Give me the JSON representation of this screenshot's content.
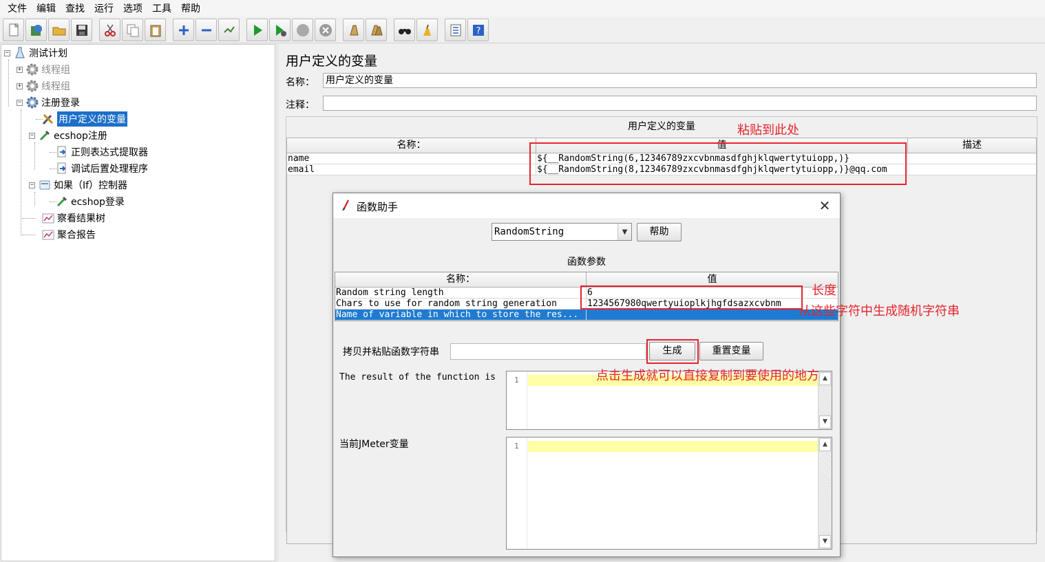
{
  "menu": [
    "文件",
    "编辑",
    "查找",
    "运行",
    "选项",
    "工具",
    "帮助"
  ],
  "toolbar_icons": [
    "new-icon",
    "templates-icon",
    "open-icon",
    "save-icon",
    "cut-icon",
    "copy-icon",
    "paste-icon",
    "expand-icon",
    "collapse-icon",
    "toggle-icon",
    "start-icon",
    "start-no-pause-icon",
    "stop-icon",
    "shutdown-icon",
    "clear-icon",
    "clear-all-icon",
    "search-icon",
    "reset-search-icon",
    "function-helper-icon",
    "help-icon"
  ],
  "tree": {
    "root": "测试计划",
    "thread_group_1": "线程组",
    "thread_group_2": "线程组",
    "register_login": "注册登录",
    "user_vars": "用户定义的变量",
    "ecshop_register": "ecshop注册",
    "regex_extractor": "正则表达式提取器",
    "debug_postprocessor": "调试后置处理程序",
    "if_controller": "如果（If）控制器",
    "ecshop_login": "ecshop登录",
    "view_results_tree": "察看结果树",
    "aggregate_report": "聚合报告"
  },
  "panel": {
    "title": "用户定义的变量",
    "name_label": "名称：",
    "name_value": "用户定义的变量",
    "comment_label": "注释：",
    "comment_value": "",
    "table_caption": "用户定义的变量",
    "columns": [
      "名称：",
      "值",
      "描述"
    ],
    "rows": [
      {
        "name": "name",
        "value": "${__RandomString(6,12346789zxcvbnmasdfghjklqwertytuiopp,)}",
        "desc": ""
      },
      {
        "name": "email",
        "value": "${__RandomString(8,12346789zxcvbnmasdfghjklqwertytuiopp,)}@qq.com",
        "desc": ""
      }
    ]
  },
  "dialog": {
    "title": "函数助手",
    "close": "✕",
    "function_select": "RandomString",
    "help_button": "帮助",
    "params_caption": "函数参数",
    "param_columns": [
      "名称：",
      "值"
    ],
    "params": [
      {
        "name": "Random string length",
        "value": "6"
      },
      {
        "name": "Chars to use for random string generation",
        "value": "1234567980qwertyuioplkjhgfdsazxcvbnm"
      },
      {
        "name": "Name of variable in which to store the res...",
        "value": ""
      }
    ],
    "copy_paste_label": "拷贝并粘贴函数字符串",
    "copy_paste_value": "",
    "generate_button": "生成",
    "reset_button": "重置变量",
    "result_label": "The result of the function is",
    "result_line_no": "1",
    "jmeter_vars_label": "当前JMeter变量",
    "jmeter_vars_line_no": "1"
  },
  "annotations": {
    "paste_here": "粘贴到此处",
    "length": "长度",
    "chars": "从这些字符中生成随机字符串",
    "click_generate": "点击生成就可以直接复制到要使用的地方"
  },
  "colors": {
    "annotation_red": "#e5242b",
    "selection_blue": "#1c6fc8",
    "editor_highlight": "#ffffa6"
  }
}
